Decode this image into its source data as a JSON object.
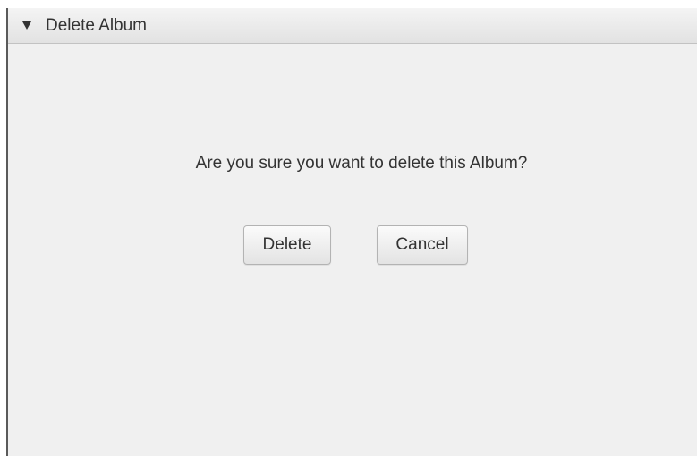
{
  "pane": {
    "title": "Delete Album",
    "arrow_icon": "triangle-down-icon"
  },
  "dialog": {
    "message": "Are you sure you want to delete this Album?",
    "delete_label": "Delete",
    "cancel_label": "Cancel"
  },
  "colors": {
    "background": "#f0f0f0",
    "text": "#333333"
  }
}
